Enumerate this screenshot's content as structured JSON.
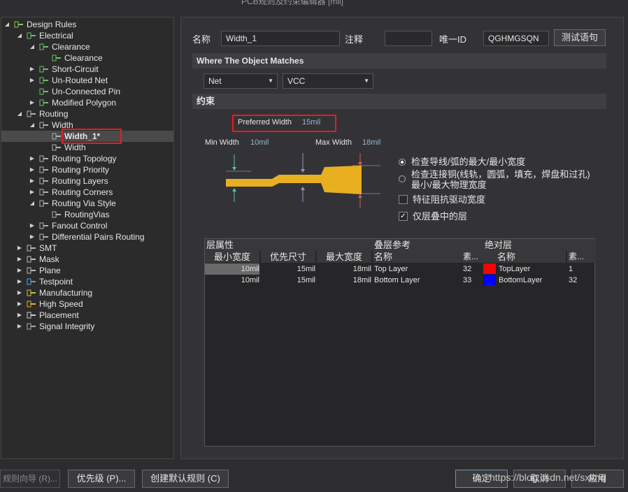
{
  "window": {
    "title": "PCB规则及约束编辑器 [mil]"
  },
  "tree": {
    "items": [
      {
        "label": "Design Rules",
        "icon": "design-rules-icon",
        "arrow": "◢",
        "depth": 0
      },
      {
        "label": "Electrical",
        "icon": "rule-icon",
        "arrow": "◢",
        "depth": 1
      },
      {
        "label": "Clearance",
        "icon": "rule-icon",
        "arrow": "◢",
        "depth": 2
      },
      {
        "label": "Clearance",
        "icon": "rule-icon",
        "arrow": "",
        "depth": 3
      },
      {
        "label": "Short-Circuit",
        "icon": "rule-icon",
        "arrow": "▶",
        "depth": 2
      },
      {
        "label": "Un-Routed Net",
        "icon": "rule-icon",
        "arrow": "▶",
        "depth": 2
      },
      {
        "label": "Un-Connected Pin",
        "icon": "rule-icon",
        "arrow": "",
        "depth": 2
      },
      {
        "label": "Modified Polygon",
        "icon": "rule-icon",
        "arrow": "▶",
        "depth": 2
      },
      {
        "label": "Routing",
        "icon": "routing-icon",
        "arrow": "◢",
        "depth": 1
      },
      {
        "label": "Width",
        "icon": "routing-icon",
        "arrow": "◢",
        "depth": 2
      },
      {
        "label": "Width_1*",
        "icon": "routing-icon",
        "arrow": "",
        "depth": 3,
        "selected": true
      },
      {
        "label": "Width",
        "icon": "routing-icon",
        "arrow": "",
        "depth": 3
      },
      {
        "label": "Routing Topology",
        "icon": "routing-icon",
        "arrow": "▶",
        "depth": 2
      },
      {
        "label": "Routing Priority",
        "icon": "routing-icon",
        "arrow": "▶",
        "depth": 2
      },
      {
        "label": "Routing Layers",
        "icon": "routing-icon",
        "arrow": "▶",
        "depth": 2
      },
      {
        "label": "Routing Corners",
        "icon": "routing-icon",
        "arrow": "▶",
        "depth": 2
      },
      {
        "label": "Routing Via Style",
        "icon": "routing-icon",
        "arrow": "◢",
        "depth": 2
      },
      {
        "label": "RoutingVias",
        "icon": "routing-icon",
        "arrow": "",
        "depth": 3
      },
      {
        "label": "Fanout Control",
        "icon": "routing-icon",
        "arrow": "▶",
        "depth": 2
      },
      {
        "label": "Differential Pairs Routing",
        "icon": "routing-icon",
        "arrow": "▶",
        "depth": 2
      },
      {
        "label": "SMT",
        "icon": "smt-icon",
        "arrow": "▶",
        "depth": 1
      },
      {
        "label": "Mask",
        "icon": "mask-icon",
        "arrow": "▶",
        "depth": 1
      },
      {
        "label": "Plane",
        "icon": "plane-icon",
        "arrow": "▶",
        "depth": 1
      },
      {
        "label": "Testpoint",
        "icon": "testpoint-icon",
        "arrow": "▶",
        "depth": 1
      },
      {
        "label": "Manufacturing",
        "icon": "manufacturing-icon",
        "arrow": "▶",
        "depth": 1
      },
      {
        "label": "High Speed",
        "icon": "high-speed-icon",
        "arrow": "▶",
        "depth": 1
      },
      {
        "label": "Placement",
        "icon": "placement-icon",
        "arrow": "▶",
        "depth": 1
      },
      {
        "label": "Signal Integrity",
        "icon": "signal-integrity-icon",
        "arrow": "▶",
        "depth": 1
      }
    ]
  },
  "rule": {
    "name_label": "名称",
    "name_value": "Width_1",
    "comment_label": "注释",
    "comment_value": "",
    "id_label": "唯一ID",
    "id_value": "QGHMGSQN",
    "test_button": "测试语句"
  },
  "match": {
    "section_title": "Where The Object Matches",
    "scope_value": "Net",
    "net_value": "VCC"
  },
  "constraints": {
    "section_title": "约束",
    "preferred_label": "Preferred Width",
    "preferred_value": "15mil",
    "min_label": "Min Width",
    "min_value": "10mil",
    "max_label": "Max Width",
    "max_value": "18mil",
    "radio_1": "检查导线/弧的最大/最小宽度",
    "radio_2": "检查连接铜(线轨，圆弧，填充，焊盘和过孔)最小/最大物理宽度",
    "check_impedance": "特征阻抗驱动宽度",
    "check_layers": "仅层叠中的层",
    "radio_selected": 1,
    "impedance_checked": false,
    "layers_checked": true,
    "trace_color": "#e8b020"
  },
  "table": {
    "group_layer_props": "层属性",
    "group_stack_ref": "叠层参考",
    "group_abs_layer": "绝对层",
    "col_min": "最小宽度",
    "col_pref": "优先尺寸",
    "col_max": "最大宽度",
    "col_name": "名称",
    "col_num": "素...",
    "col_abs_name": "名称",
    "col_abs_num": "素...",
    "rows": [
      {
        "min": "10mil",
        "pref": "15mil",
        "max": "18mil",
        "name": "Top Layer",
        "num": "32",
        "color": "#ff0000",
        "abs_name": "TopLayer",
        "abs_num": "1"
      },
      {
        "min": "10mil",
        "pref": "15mil",
        "max": "18mil",
        "name": "Bottom Layer",
        "num": "33",
        "color": "#0000ff",
        "abs_name": "BottomLayer",
        "abs_num": "32"
      }
    ]
  },
  "footer": {
    "wizard": "规则向导 (R)...",
    "priority": "优先级 (P)...",
    "create_default": "创建默认规则 (C)",
    "ok": "确定",
    "cancel": "取消",
    "apply": "应用",
    "watermark": "https://blog.csdn.net/sxlmq"
  }
}
